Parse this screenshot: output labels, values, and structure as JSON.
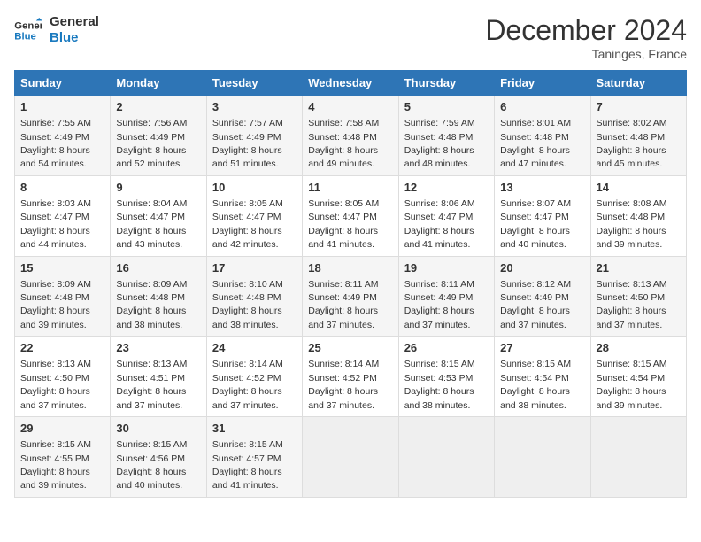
{
  "logo": {
    "line1": "General",
    "line2": "Blue"
  },
  "title": "December 2024",
  "location": "Taninges, France",
  "headers": [
    "Sunday",
    "Monday",
    "Tuesday",
    "Wednesday",
    "Thursday",
    "Friday",
    "Saturday"
  ],
  "weeks": [
    [
      {
        "day": "1",
        "sunrise": "Sunrise: 7:55 AM",
        "sunset": "Sunset: 4:49 PM",
        "daylight": "Daylight: 8 hours and 54 minutes."
      },
      {
        "day": "2",
        "sunrise": "Sunrise: 7:56 AM",
        "sunset": "Sunset: 4:49 PM",
        "daylight": "Daylight: 8 hours and 52 minutes."
      },
      {
        "day": "3",
        "sunrise": "Sunrise: 7:57 AM",
        "sunset": "Sunset: 4:49 PM",
        "daylight": "Daylight: 8 hours and 51 minutes."
      },
      {
        "day": "4",
        "sunrise": "Sunrise: 7:58 AM",
        "sunset": "Sunset: 4:48 PM",
        "daylight": "Daylight: 8 hours and 49 minutes."
      },
      {
        "day": "5",
        "sunrise": "Sunrise: 7:59 AM",
        "sunset": "Sunset: 4:48 PM",
        "daylight": "Daylight: 8 hours and 48 minutes."
      },
      {
        "day": "6",
        "sunrise": "Sunrise: 8:01 AM",
        "sunset": "Sunset: 4:48 PM",
        "daylight": "Daylight: 8 hours and 47 minutes."
      },
      {
        "day": "7",
        "sunrise": "Sunrise: 8:02 AM",
        "sunset": "Sunset: 4:48 PM",
        "daylight": "Daylight: 8 hours and 45 minutes."
      }
    ],
    [
      {
        "day": "8",
        "sunrise": "Sunrise: 8:03 AM",
        "sunset": "Sunset: 4:47 PM",
        "daylight": "Daylight: 8 hours and 44 minutes."
      },
      {
        "day": "9",
        "sunrise": "Sunrise: 8:04 AM",
        "sunset": "Sunset: 4:47 PM",
        "daylight": "Daylight: 8 hours and 43 minutes."
      },
      {
        "day": "10",
        "sunrise": "Sunrise: 8:05 AM",
        "sunset": "Sunset: 4:47 PM",
        "daylight": "Daylight: 8 hours and 42 minutes."
      },
      {
        "day": "11",
        "sunrise": "Sunrise: 8:05 AM",
        "sunset": "Sunset: 4:47 PM",
        "daylight": "Daylight: 8 hours and 41 minutes."
      },
      {
        "day": "12",
        "sunrise": "Sunrise: 8:06 AM",
        "sunset": "Sunset: 4:47 PM",
        "daylight": "Daylight: 8 hours and 41 minutes."
      },
      {
        "day": "13",
        "sunrise": "Sunrise: 8:07 AM",
        "sunset": "Sunset: 4:47 PM",
        "daylight": "Daylight: 8 hours and 40 minutes."
      },
      {
        "day": "14",
        "sunrise": "Sunrise: 8:08 AM",
        "sunset": "Sunset: 4:48 PM",
        "daylight": "Daylight: 8 hours and 39 minutes."
      }
    ],
    [
      {
        "day": "15",
        "sunrise": "Sunrise: 8:09 AM",
        "sunset": "Sunset: 4:48 PM",
        "daylight": "Daylight: 8 hours and 39 minutes."
      },
      {
        "day": "16",
        "sunrise": "Sunrise: 8:09 AM",
        "sunset": "Sunset: 4:48 PM",
        "daylight": "Daylight: 8 hours and 38 minutes."
      },
      {
        "day": "17",
        "sunrise": "Sunrise: 8:10 AM",
        "sunset": "Sunset: 4:48 PM",
        "daylight": "Daylight: 8 hours and 38 minutes."
      },
      {
        "day": "18",
        "sunrise": "Sunrise: 8:11 AM",
        "sunset": "Sunset: 4:49 PM",
        "daylight": "Daylight: 8 hours and 37 minutes."
      },
      {
        "day": "19",
        "sunrise": "Sunrise: 8:11 AM",
        "sunset": "Sunset: 4:49 PM",
        "daylight": "Daylight: 8 hours and 37 minutes."
      },
      {
        "day": "20",
        "sunrise": "Sunrise: 8:12 AM",
        "sunset": "Sunset: 4:49 PM",
        "daylight": "Daylight: 8 hours and 37 minutes."
      },
      {
        "day": "21",
        "sunrise": "Sunrise: 8:13 AM",
        "sunset": "Sunset: 4:50 PM",
        "daylight": "Daylight: 8 hours and 37 minutes."
      }
    ],
    [
      {
        "day": "22",
        "sunrise": "Sunrise: 8:13 AM",
        "sunset": "Sunset: 4:50 PM",
        "daylight": "Daylight: 8 hours and 37 minutes."
      },
      {
        "day": "23",
        "sunrise": "Sunrise: 8:13 AM",
        "sunset": "Sunset: 4:51 PM",
        "daylight": "Daylight: 8 hours and 37 minutes."
      },
      {
        "day": "24",
        "sunrise": "Sunrise: 8:14 AM",
        "sunset": "Sunset: 4:52 PM",
        "daylight": "Daylight: 8 hours and 37 minutes."
      },
      {
        "day": "25",
        "sunrise": "Sunrise: 8:14 AM",
        "sunset": "Sunset: 4:52 PM",
        "daylight": "Daylight: 8 hours and 37 minutes."
      },
      {
        "day": "26",
        "sunrise": "Sunrise: 8:15 AM",
        "sunset": "Sunset: 4:53 PM",
        "daylight": "Daylight: 8 hours and 38 minutes."
      },
      {
        "day": "27",
        "sunrise": "Sunrise: 8:15 AM",
        "sunset": "Sunset: 4:54 PM",
        "daylight": "Daylight: 8 hours and 38 minutes."
      },
      {
        "day": "28",
        "sunrise": "Sunrise: 8:15 AM",
        "sunset": "Sunset: 4:54 PM",
        "daylight": "Daylight: 8 hours and 39 minutes."
      }
    ],
    [
      {
        "day": "29",
        "sunrise": "Sunrise: 8:15 AM",
        "sunset": "Sunset: 4:55 PM",
        "daylight": "Daylight: 8 hours and 39 minutes."
      },
      {
        "day": "30",
        "sunrise": "Sunrise: 8:15 AM",
        "sunset": "Sunset: 4:56 PM",
        "daylight": "Daylight: 8 hours and 40 minutes."
      },
      {
        "day": "31",
        "sunrise": "Sunrise: 8:15 AM",
        "sunset": "Sunset: 4:57 PM",
        "daylight": "Daylight: 8 hours and 41 minutes."
      },
      null,
      null,
      null,
      null
    ]
  ]
}
